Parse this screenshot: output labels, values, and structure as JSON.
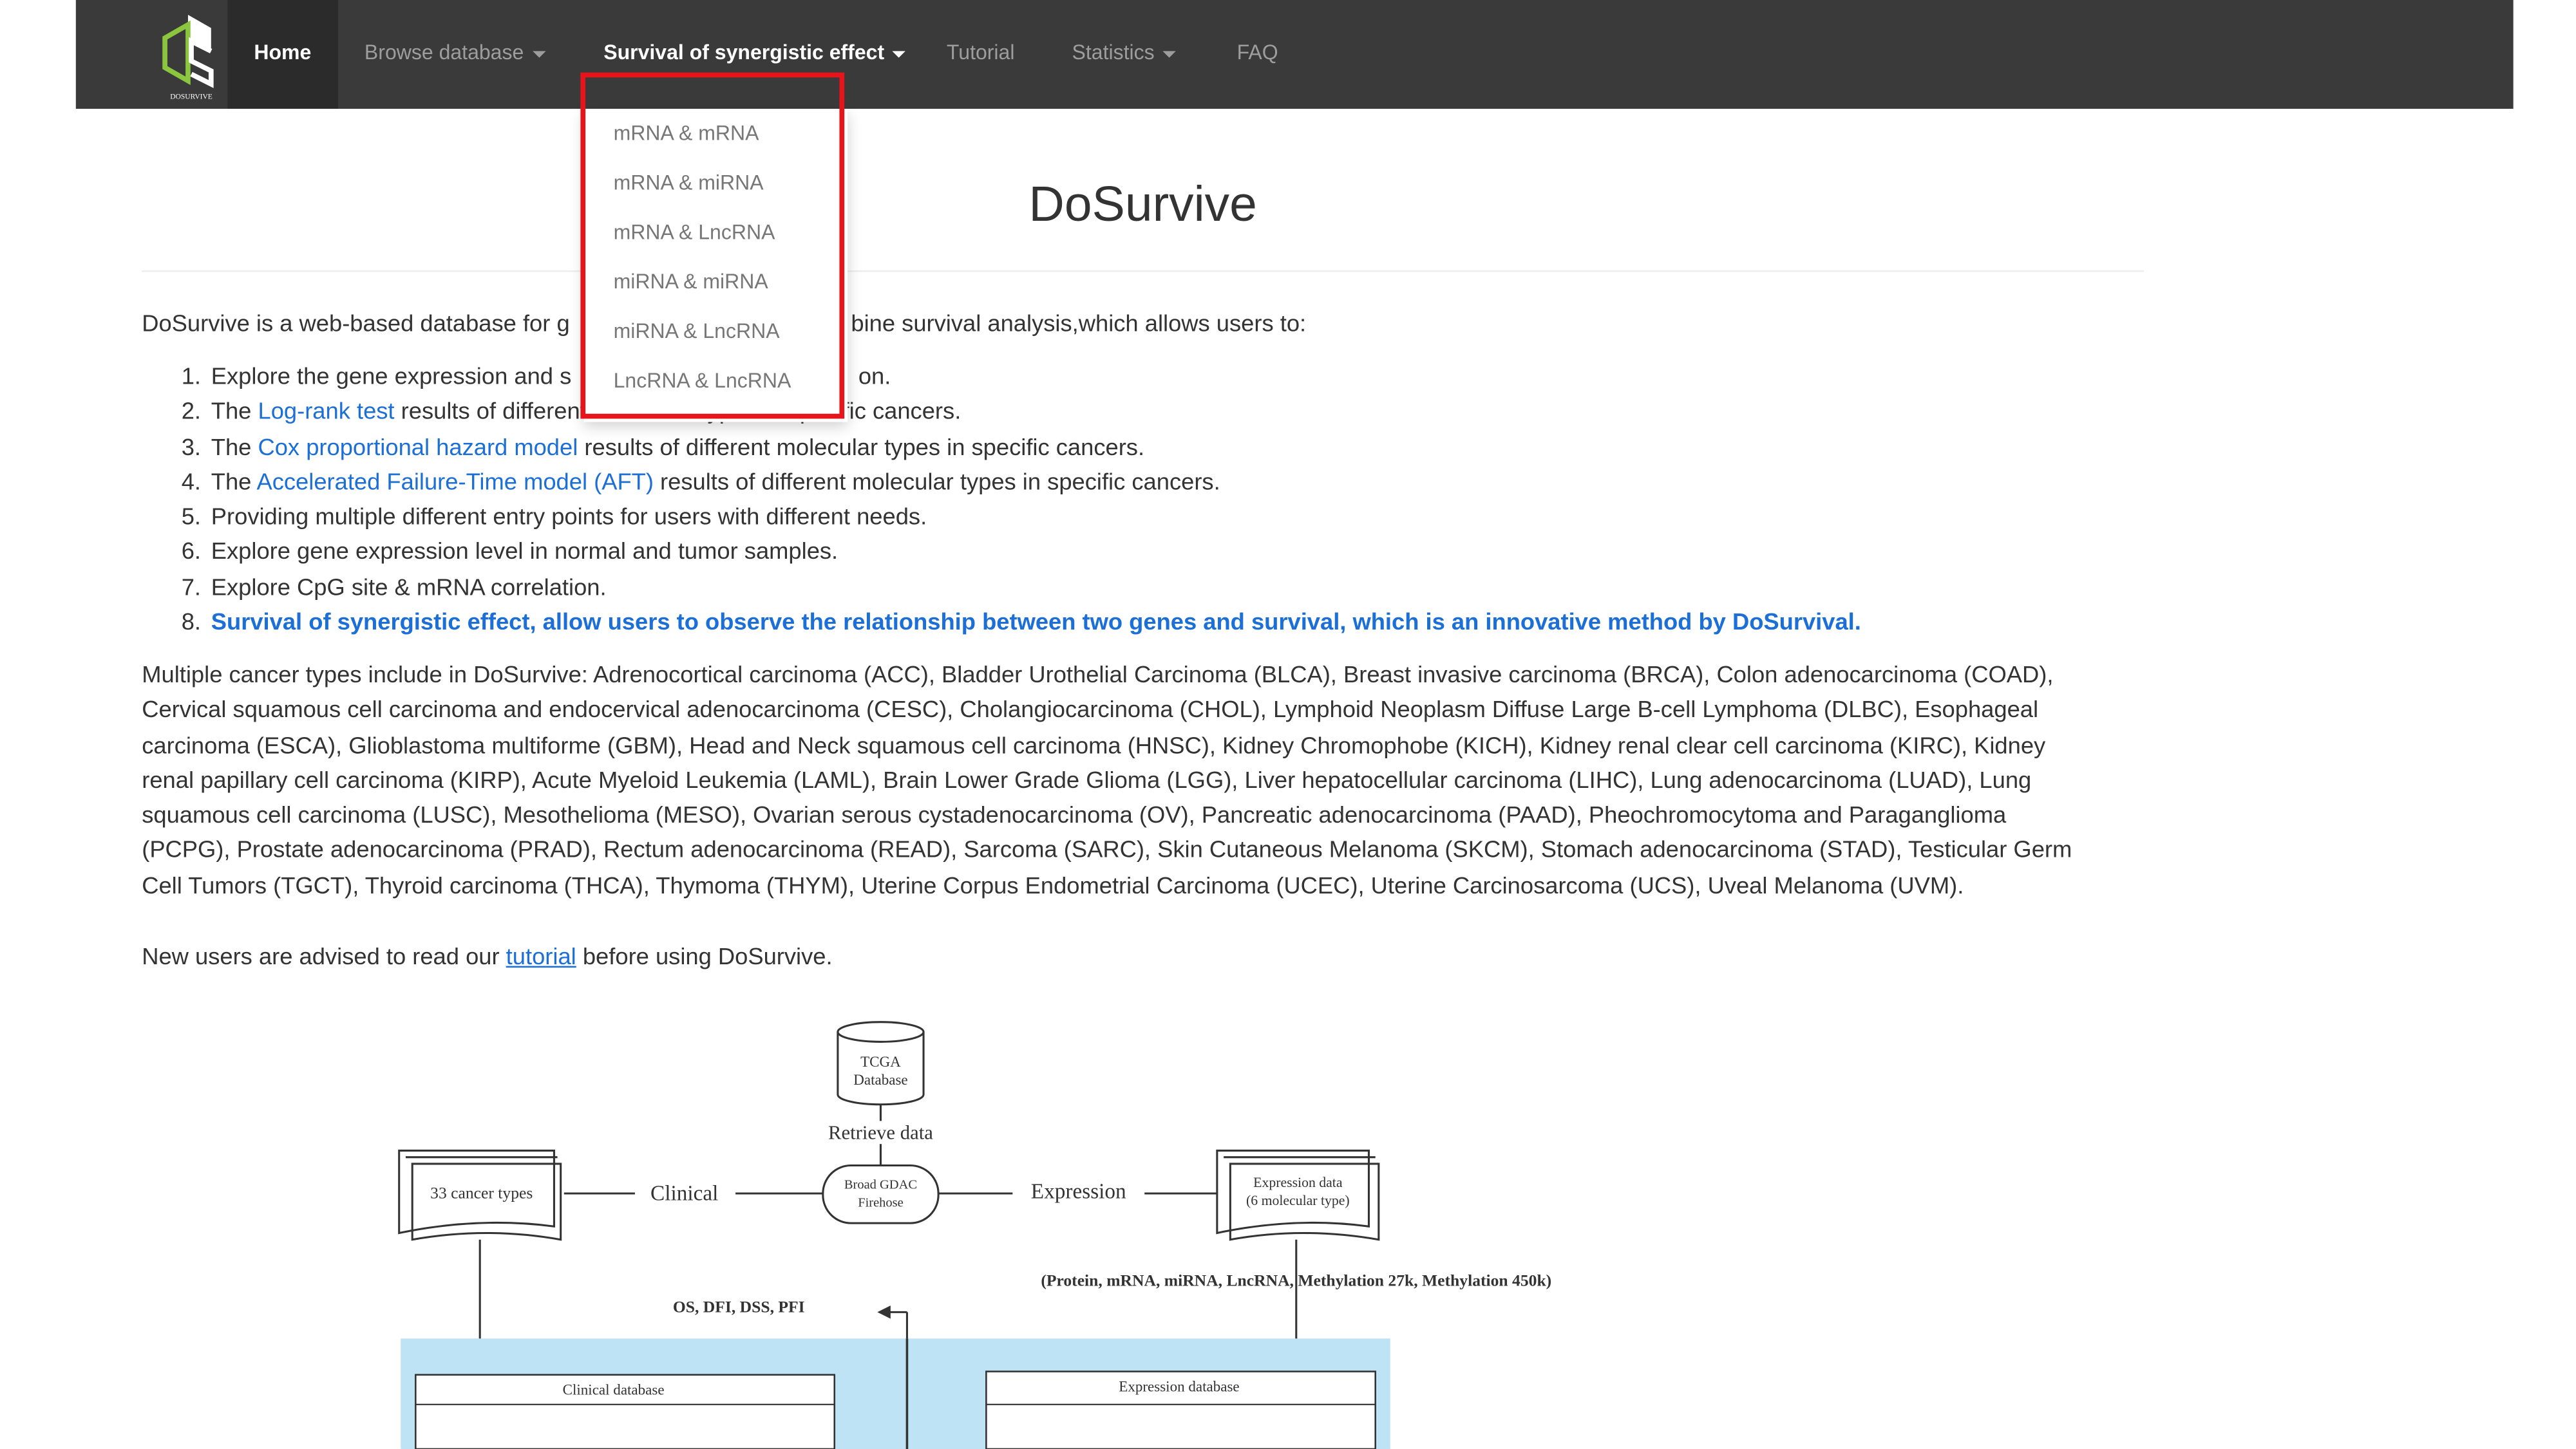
{
  "nav": {
    "home": "Home",
    "browse": "Browse database",
    "survival": "Survival of synergistic effect",
    "tutorial": "Tutorial",
    "statistics": "Statistics",
    "faq": "FAQ",
    "logo_text": "DOSURVIVE"
  },
  "dropdown": [
    "mRNA & mRNA",
    "mRNA & miRNA",
    "mRNA & LncRNA",
    "miRNA & miRNA",
    "miRNA & LncRNA",
    "LncRNA & LncRNA"
  ],
  "title": "DoSurvive",
  "intro_left": "DoSurvive is a web-based database for g",
  "intro_right": "bine survival analysis,which allows users to:",
  "list": {
    "i1_num": "1.",
    "i1_a": "Explore the gene expression and s",
    "i1_b": "on.",
    "i2_num": "2.",
    "i2_a": "The ",
    "i2_link": "Log-rank test",
    "i2_b": " results of different molecular types in specific cancers.",
    "i3_num": "3.",
    "i3_a": "The ",
    "i3_link": "Cox proportional hazard model",
    "i3_b": " results of different molecular types in specific cancers.",
    "i4_num": "4.",
    "i4_a": "The ",
    "i4_link": "Accelerated Failure-Time model (AFT)",
    "i4_b": " results of different molecular types in specific cancers.",
    "i5_num": "5.",
    "i5": "Providing multiple different entry points for users with different needs.",
    "i6_num": "6.",
    "i6": "Explore gene expression level in normal and tumor samples.",
    "i7_num": "7.",
    "i7": "Explore CpG site & mRNA correlation.",
    "i8_num": "8.",
    "i8": "Survival of synergistic effect, allow users to observe the relationship between two genes and survival, which is an innovative method by DoSurvival."
  },
  "cancer_lines": [
    "Multiple cancer types include in DoSurvive: Adrenocortical carcinoma (ACC), Bladder Urothelial Carcinoma (BLCA), Breast invasive carcinoma (BRCA), Colon adenocarcinoma (COAD),",
    "Cervical squamous cell carcinoma and endocervical adenocarcinoma (CESC), Cholangiocarcinoma (CHOL), Lymphoid Neoplasm Diffuse Large B-cell Lymphoma (DLBC), Esophageal",
    "carcinoma (ESCA), Glioblastoma multiforme (GBM), Head and Neck squamous cell carcinoma (HNSC), Kidney Chromophobe (KICH), Kidney renal clear cell carcinoma (KIRC), Kidney",
    "renal papillary cell carcinoma (KIRP), Acute Myeloid Leukemia (LAML), Brain Lower Grade Glioma (LGG), Liver hepatocellular carcinoma (LIHC), Lung adenocarcinoma (LUAD), Lung",
    "squamous cell carcinoma (LUSC), Mesothelioma (MESO), Ovarian serous cystadenocarcinoma (OV), Pancreatic adenocarcinoma (PAAD), Pheochromocytoma and Paraganglioma",
    "(PCPG), Prostate adenocarcinoma (PRAD), Rectum adenocarcinoma (READ), Sarcoma (SARC), Skin Cutaneous Melanoma (SKCM), Stomach adenocarcinoma (STAD), Testicular Germ",
    "Cell Tumors (TGCT), Thyroid carcinoma (THCA), Thymoma (THYM), Uterine Corpus Endometrial Carcinoma (UCEC), Uterine Carcinosarcoma (UCS), Uveal Melanoma (UVM)."
  ],
  "advice_a": "New users are advised to read our ",
  "advice_link": "tutorial",
  "advice_b": " before using DoSurvive.",
  "diagram": {
    "tcga": "TCGA",
    "database": "Database",
    "retrieve": "Retrieve data",
    "cancer_types": "33 cancer types",
    "clinical": "Clinical",
    "broad1": "Broad GDAC",
    "broad2": "Firehose",
    "expression": "Expression",
    "exp_data1": "Expression data",
    "exp_data2": "(6 molecular type)",
    "molecules": "(Protein, mRNA, miRNA, LncRNA, Methylation 27k, Methylation 450k)",
    "endpoints": "OS, DFI, DSS, PFI",
    "clinical_db": "Clinical database",
    "expression_db": "Expression database"
  }
}
